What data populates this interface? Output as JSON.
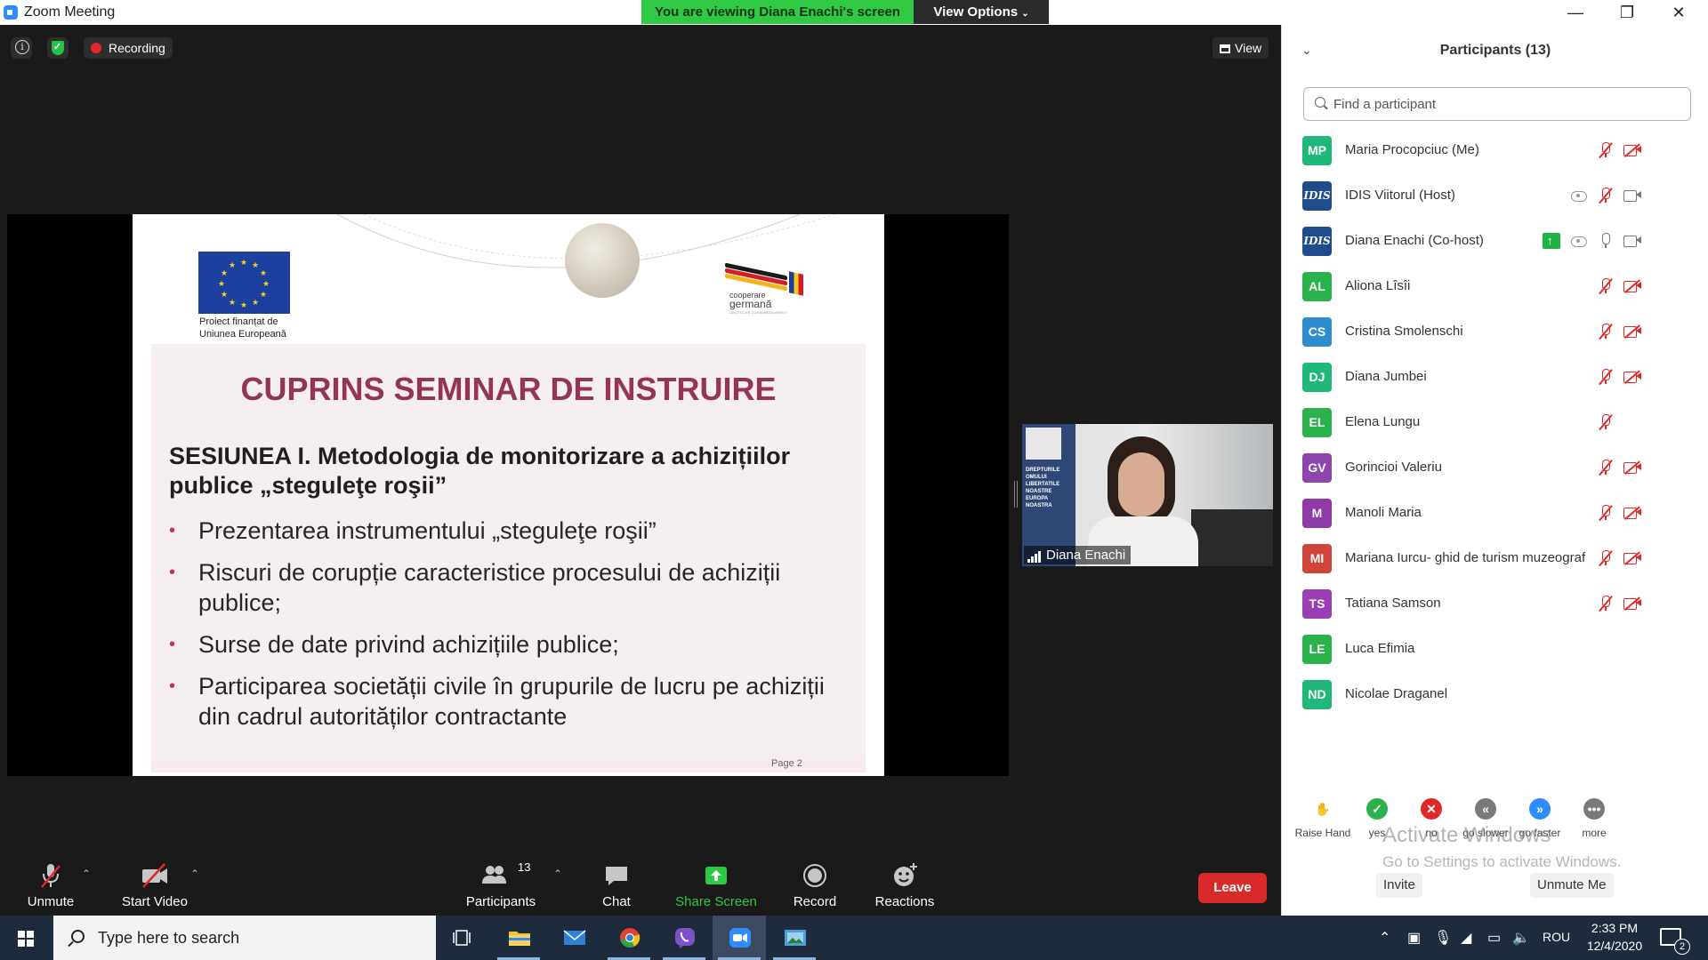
{
  "window": {
    "title": "Zoom Meeting",
    "viewing_banner": "You are viewing Diana Enachi's screen",
    "view_options": "View Options"
  },
  "meeting": {
    "recording_label": "Recording",
    "view_label": "View"
  },
  "slide": {
    "eu_caption_line1": "Proiect finanțat de",
    "eu_caption_line2": "Uniunea  Europeană",
    "cg_line1": "cooperare",
    "cg_line2": "germană",
    "cg_line3": "DEUTSCHE ZUSAMMENARBEIT",
    "title": "CUPRINS SEMINAR DE INSTRUIRE",
    "subtitle": "SESIUNEA I. Metodologia de monitorizare a achizițiilor publice „steguleţe roşii”",
    "bullets": [
      "Prezentarea instrumentului „steguleţe roşii”",
      "Riscuri de corupție caracteristice procesului de achiziții publice;",
      "Surse de date privind achizițiile publice;",
      "Participarea societății civile în grupurile de lucru pe achiziții din cadrul autorităților contractante"
    ],
    "bullet_glyph": "•",
    "page_label": "Page 2",
    "poster_text": "DREPTURILE OMULUI LIBERTATILE NOASTRE EUROPA NOASTRA"
  },
  "speaker": {
    "name": "Diana Enachi"
  },
  "toolbar": {
    "unmute": "Unmute",
    "start_video": "Start Video",
    "participants": "Participants",
    "participants_count": "13",
    "chat": "Chat",
    "share_screen": "Share Screen",
    "record": "Record",
    "reactions": "Reactions",
    "leave": "Leave",
    "accent_share": "#2fc943",
    "leave_color": "#d82a2a"
  },
  "panel": {
    "title": "Participants (13)",
    "search_placeholder": "Find a participant",
    "participants": [
      {
        "initials": "MP",
        "name": "Maria Procopciuc (Me)",
        "color": "#1fb87a",
        "logo": false
      },
      {
        "initials": "IDIS",
        "name": "IDIS Viitorul (Host)",
        "color": "#1f4d8c",
        "logo": true
      },
      {
        "initials": "IDIS",
        "name": "Diana Enachi (Co-host)",
        "color": "#1f4d8c",
        "logo": true
      },
      {
        "initials": "AL",
        "name": "Aliona Lîsîi",
        "color": "#2bb24c",
        "logo": false
      },
      {
        "initials": "CS",
        "name": "Cristina Smolenschi",
        "color": "#2f8ccf",
        "logo": false
      },
      {
        "initials": "DJ",
        "name": "Diana Jumbei",
        "color": "#1fb87a",
        "logo": false
      },
      {
        "initials": "EL",
        "name": "Elena Lungu",
        "color": "#2bb24c",
        "logo": false
      },
      {
        "initials": "GV",
        "name": "Gorincioi Valeriu",
        "color": "#8e44ad",
        "logo": false
      },
      {
        "initials": "M",
        "name": "Manoli Maria",
        "color": "#8e3aa8",
        "logo": false
      },
      {
        "initials": "MI",
        "name": "Mariana Iurcu- ghid de turism muzeograf",
        "color": "#d0453a",
        "logo": false
      },
      {
        "initials": "TS",
        "name": "Tatiana Samson",
        "color": "#9b3db5",
        "logo": false
      },
      {
        "initials": "LE",
        "name": "Luca Efimia",
        "color": "#2bb24c",
        "logo": false
      },
      {
        "initials": "ND",
        "name": "Nicolae Draganel",
        "color": "#1fb87a",
        "logo": false
      }
    ],
    "reactions": [
      {
        "label": "Raise Hand",
        "glyph": "✋",
        "color": "#ffffff",
        "fg": "#2d8cff"
      },
      {
        "label": "yes",
        "glyph": "✓",
        "color": "#2bb24c",
        "fg": "#ffffff"
      },
      {
        "label": "no",
        "glyph": "✕",
        "color": "#e02828",
        "fg": "#ffffff"
      },
      {
        "label": "go slower",
        "glyph": "«",
        "color": "#7a7a7a",
        "fg": "#ffffff"
      },
      {
        "label": "go faster",
        "glyph": "»",
        "color": "#2d8cff",
        "fg": "#ffffff"
      },
      {
        "label": "more",
        "glyph": "•••",
        "color": "#7a7a7a",
        "fg": "#ffffff"
      }
    ],
    "activate_line1": "Activate Windows",
    "activate_line2": "Go to Settings to activate Windows.",
    "invite": "Invite",
    "unmute_me": "Unmute Me"
  },
  "taskbar": {
    "search_placeholder": "Type here to search",
    "language": "ROU",
    "time": "2:33 PM",
    "date": "12/4/2020",
    "notification_count": "2"
  }
}
